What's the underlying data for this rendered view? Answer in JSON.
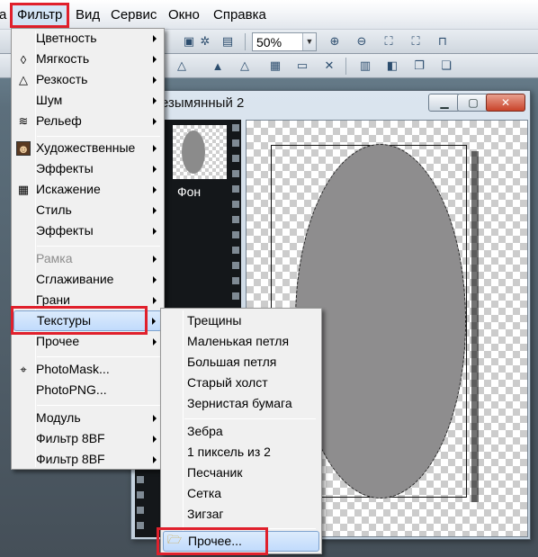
{
  "menubar": {
    "items": [
      {
        "label": "а"
      },
      {
        "label": "Фильтр"
      },
      {
        "label": "Вид"
      },
      {
        "label": "Сервис"
      },
      {
        "label": "Окно"
      },
      {
        "label": "Справка"
      }
    ]
  },
  "toolbar": {
    "zoom_value": "50%"
  },
  "document": {
    "title": "езымянный 2",
    "layer_label": "Фон",
    "canvas_color": "#8e8d8e"
  },
  "filter_menu": {
    "items": [
      {
        "label": "Цветность",
        "submenu": true
      },
      {
        "label": "Мягкость",
        "submenu": true,
        "icon": "drop-icon"
      },
      {
        "label": "Резкость",
        "submenu": true,
        "icon": "triangle-icon"
      },
      {
        "label": "Шум",
        "submenu": true
      },
      {
        "label": "Рельеф",
        "submenu": true,
        "icon": "emboss-icon"
      },
      {
        "label": "Художественные",
        "submenu": true,
        "icon": "portrait-icon"
      },
      {
        "label": "Эффекты",
        "submenu": true
      },
      {
        "label": "Искажение",
        "submenu": true,
        "icon": "grid-icon"
      },
      {
        "label": "Стиль",
        "submenu": true
      },
      {
        "label": "Эффекты",
        "submenu": true
      },
      {
        "label": "Рамка",
        "submenu": true,
        "disabled": true
      },
      {
        "label": "Сглаживание",
        "submenu": true
      },
      {
        "label": "Грани",
        "submenu": true
      },
      {
        "label": "Текстуры",
        "submenu": true
      },
      {
        "label": "Прочее",
        "submenu": true
      },
      {
        "label": "PhotoMask...",
        "icon": "photomask-icon"
      },
      {
        "label": "PhotoPNG..."
      },
      {
        "label": "Модуль",
        "submenu": true
      },
      {
        "label": "Фильтр 8BF",
        "submenu": true
      },
      {
        "label": "Фильтр 8BF",
        "submenu": true
      }
    ]
  },
  "textures_submenu": {
    "items": [
      {
        "label": "Трещины"
      },
      {
        "label": "Маленькая петля"
      },
      {
        "label": "Большая петля"
      },
      {
        "label": "Старый холст"
      },
      {
        "label": "Зернистая бумага"
      },
      {
        "label": "Зебра"
      },
      {
        "label": "1 пиксель из 2"
      },
      {
        "label": "Песчаник"
      },
      {
        "label": "Сетка"
      },
      {
        "label": "Зигзаг"
      },
      {
        "label": "Прочее...",
        "icon": "folder-open-icon"
      }
    ]
  },
  "colors": {
    "highlight_border": "#e0202c",
    "menu_bg": "#f0f0f0",
    "hover_bg": "#c1dbfc"
  }
}
